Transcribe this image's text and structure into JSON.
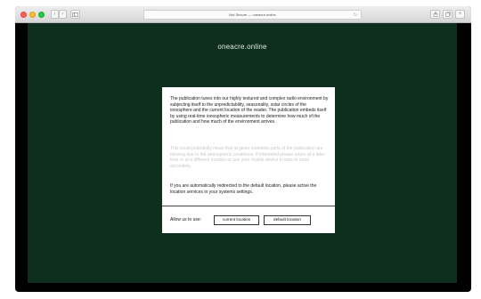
{
  "browser": {
    "url_text": "Not Secure — oneacre.online",
    "security_text": "Not Secure"
  },
  "page": {
    "site_title": "oneacre.online",
    "paragraphs": [
      "The publication tunes into our highly textured and complex radio environment by subjecting itself to the unpredictability, seasonality, solar circles of the ionosphere and the current location of the reader. The publication embeds itself by using real-time ionospheric measurements to determine how much of the publication and how much of the environment arrives.",
      "This could potentially mean that at given moments parts of the publication are missing due to the atmospheric conditions. If interested please return at a later time or at a different location or use your mobile device to tune in more accurately.",
      "If you are automatically redirected to the default location, please active the location services in your systems settings."
    ],
    "allow_label": "Allow us to use:",
    "buttons": {
      "current": "current location",
      "default": "default location"
    }
  }
}
